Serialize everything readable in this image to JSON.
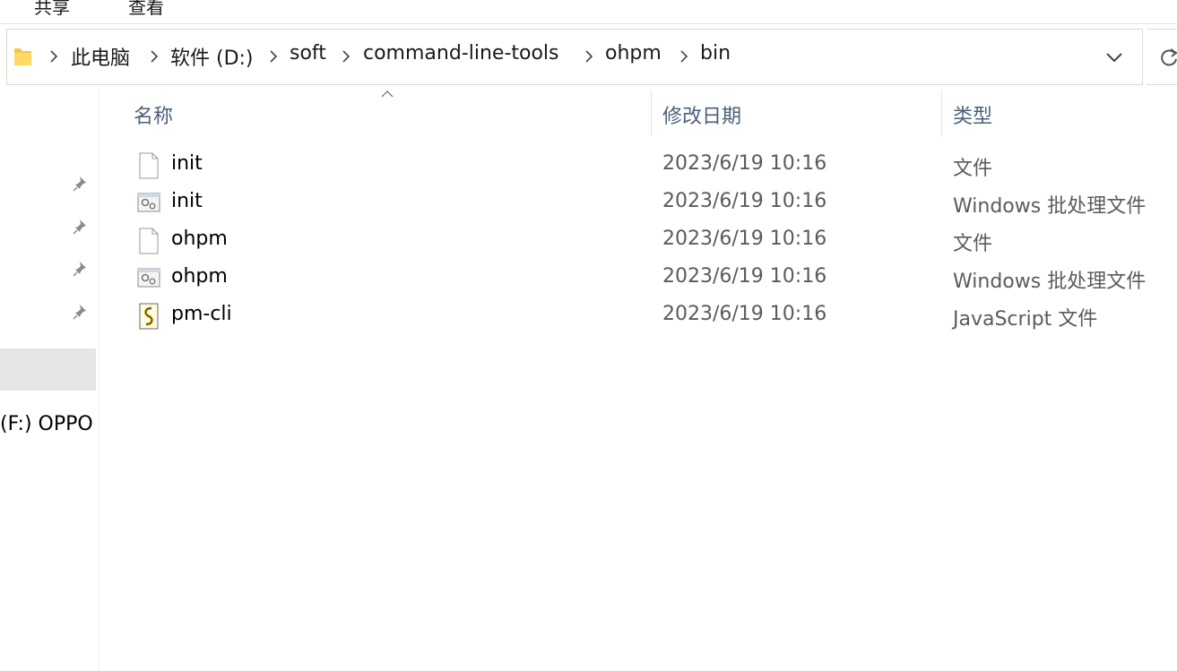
{
  "ribbon": {
    "tabs": [
      "共享",
      "查看"
    ]
  },
  "address_bar": {
    "breadcrumbs": [
      "此电脑",
      "软件 (D:)",
      "soft",
      "command-line-tools",
      "ohpm",
      "bin"
    ]
  },
  "nav_pane": {
    "pinned_count": 4,
    "drive_label": "(F:) OPPO"
  },
  "columns": {
    "name": "名称",
    "date": "修改日期",
    "type": "类型"
  },
  "files": [
    {
      "name": "init",
      "date": "2023/6/19 10:16",
      "type": "文件",
      "icon": "generic-file-icon"
    },
    {
      "name": "init",
      "date": "2023/6/19 10:16",
      "type": "Windows 批处理文件",
      "icon": "batch-file-icon"
    },
    {
      "name": "ohpm",
      "date": "2023/6/19 10:16",
      "type": "文件",
      "icon": "generic-file-icon"
    },
    {
      "name": "ohpm",
      "date": "2023/6/19 10:16",
      "type": "Windows 批处理文件",
      "icon": "batch-file-icon"
    },
    {
      "name": "pm-cli",
      "date": "2023/6/19 10:16",
      "type": "JavaScript 文件",
      "icon": "javascript-file-icon"
    }
  ]
}
